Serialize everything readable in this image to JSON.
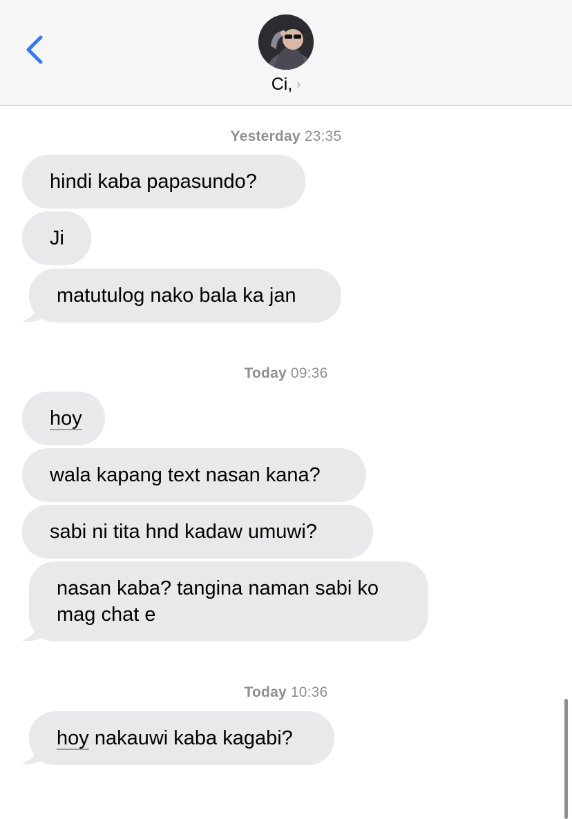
{
  "header": {
    "back_icon": "chevron-left-icon",
    "contact_name": "Ci,",
    "contact_chevron": "›",
    "accent": "#3478f6"
  },
  "colors": {
    "incoming_bubble": "#e9e9eb",
    "timestamp": "#8e8e93",
    "header_bg": "#f6f6f6"
  },
  "conversation": {
    "groups": [
      {
        "day": "Yesterday",
        "time": "23:35",
        "messages": [
          "hindi kaba papasundo?",
          "Ji",
          "matutulog nako bala ka jan"
        ]
      },
      {
        "day": "Today",
        "time": "09:36",
        "messages": [
          "hoy",
          "wala kapang text nasan kana?",
          "sabi ni tita hnd kadaw umuwi?",
          "nasan kaba? tangina naman sabi ko mag chat e"
        ]
      },
      {
        "day": "Today",
        "time": "10:36",
        "messages": [
          "hoy nakauwi kaba kagabi?"
        ]
      }
    ]
  }
}
